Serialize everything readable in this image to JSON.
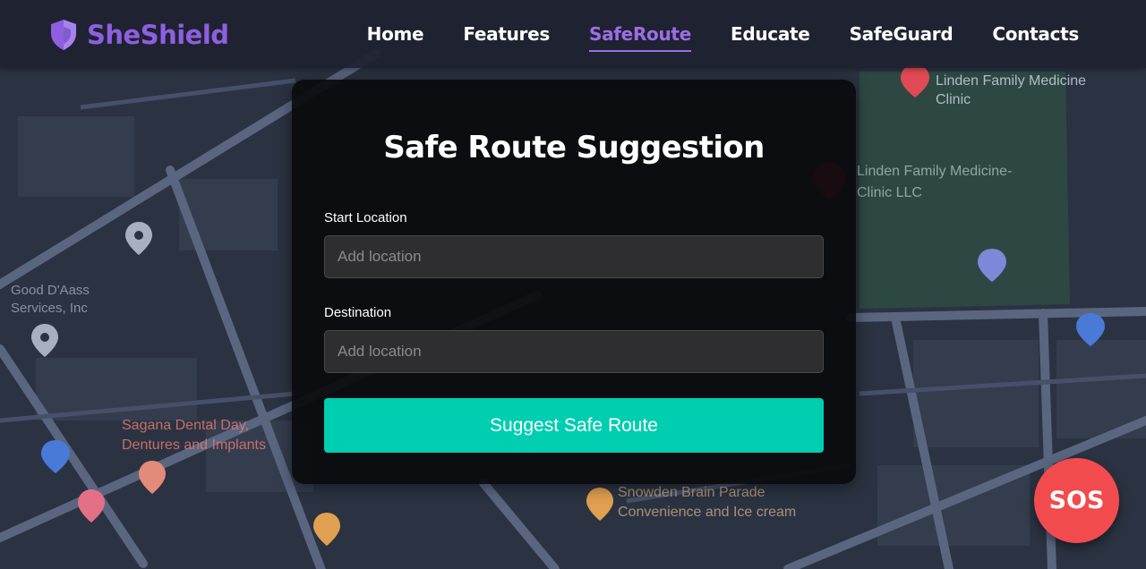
{
  "brand": {
    "name": "SheShield",
    "icon": "shield-icon",
    "color": "#8e5fe0"
  },
  "nav": {
    "items": [
      {
        "label": "Home",
        "active": false
      },
      {
        "label": "Features",
        "active": false
      },
      {
        "label": "SafeRoute",
        "active": true
      },
      {
        "label": "Educate",
        "active": false
      },
      {
        "label": "SafeGuard",
        "active": false
      },
      {
        "label": "Contacts",
        "active": false
      }
    ]
  },
  "form": {
    "title": "Safe Route Suggestion",
    "start": {
      "label": "Start Location",
      "placeholder": "Add location",
      "value": ""
    },
    "destination": {
      "label": "Destination",
      "placeholder": "Add location",
      "value": ""
    },
    "submit_label": "Suggest Safe Route",
    "accent": "#00ceb0"
  },
  "sos": {
    "label": "SOS",
    "color": "#f24b4e"
  },
  "map_labels": [
    "Linden Family Medicine Clinic",
    "Linden Family Medicine-Clinic LLC",
    "Good D'Aass Services, Inc",
    "Sagana Dental Day, Dentures and Implants",
    "Snowden Brain Parade Convenience and Ice cream"
  ]
}
